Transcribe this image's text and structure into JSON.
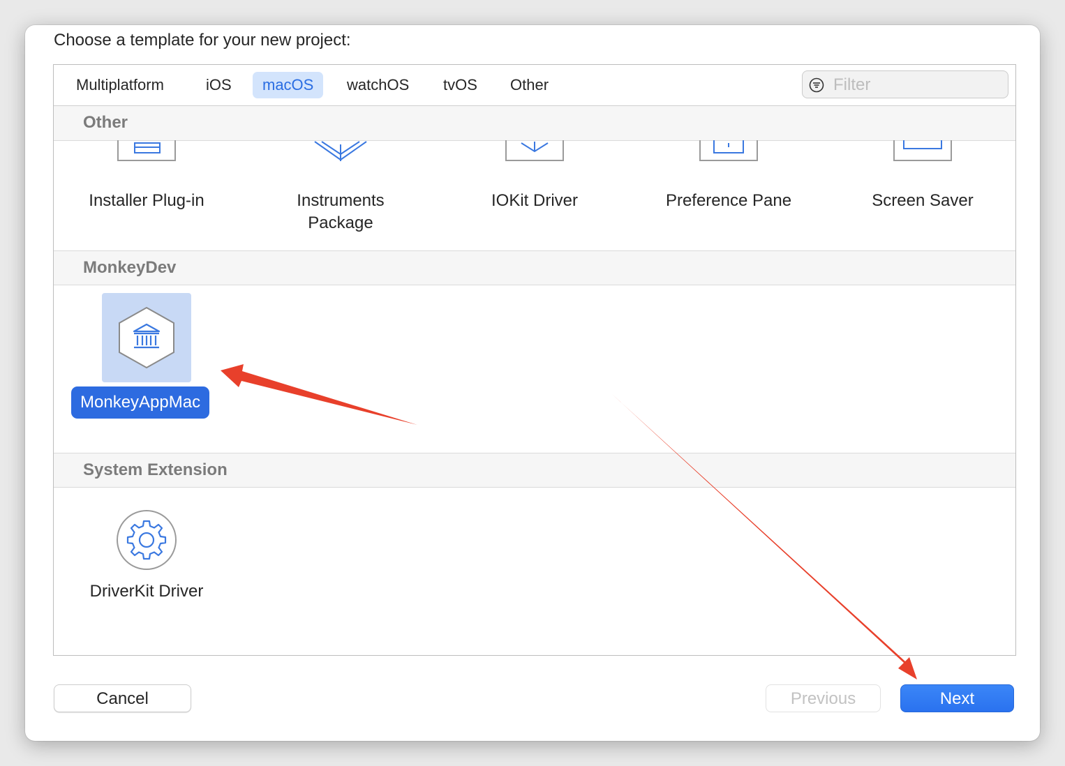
{
  "dialog": {
    "heading": "Choose a template for your new project:"
  },
  "tabs": [
    {
      "label": "Multiplatform",
      "selected": false
    },
    {
      "label": "iOS",
      "selected": false
    },
    {
      "label": "macOS",
      "selected": true
    },
    {
      "label": "watchOS",
      "selected": false
    },
    {
      "label": "tvOS",
      "selected": false
    },
    {
      "label": "Other",
      "selected": false
    }
  ],
  "filter": {
    "placeholder": "Filter",
    "value": "",
    "icon": "filter-icon"
  },
  "sections": [
    {
      "title": "Other",
      "templates": [
        {
          "label": "Installer Plug-in",
          "icon": "installer-plugin-icon"
        },
        {
          "label": "Instruments Package",
          "icon": "instruments-package-icon"
        },
        {
          "label": "IOKit Driver",
          "icon": "iokit-driver-icon"
        },
        {
          "label": "Preference Pane",
          "icon": "preference-pane-icon"
        },
        {
          "label": "Screen Saver",
          "icon": "screen-saver-icon"
        }
      ]
    },
    {
      "title": "MonkeyDev",
      "templates": [
        {
          "label": "MonkeyAppMac",
          "icon": "bank-building-icon",
          "selected": true
        }
      ]
    },
    {
      "title": "System Extension",
      "templates": [
        {
          "label": "DriverKit Driver",
          "icon": "gear-icon"
        }
      ]
    }
  ],
  "buttons": {
    "cancel": "Cancel",
    "previous": "Previous",
    "next": "Next",
    "previous_enabled": false
  },
  "colors": {
    "accent": "#2d6be0",
    "selection_bg": "#c8d9f5",
    "tab_selected_bg": "#d3e4fc",
    "annotation_arrow": "#e8402b",
    "icon_blue": "#3a78e0"
  }
}
